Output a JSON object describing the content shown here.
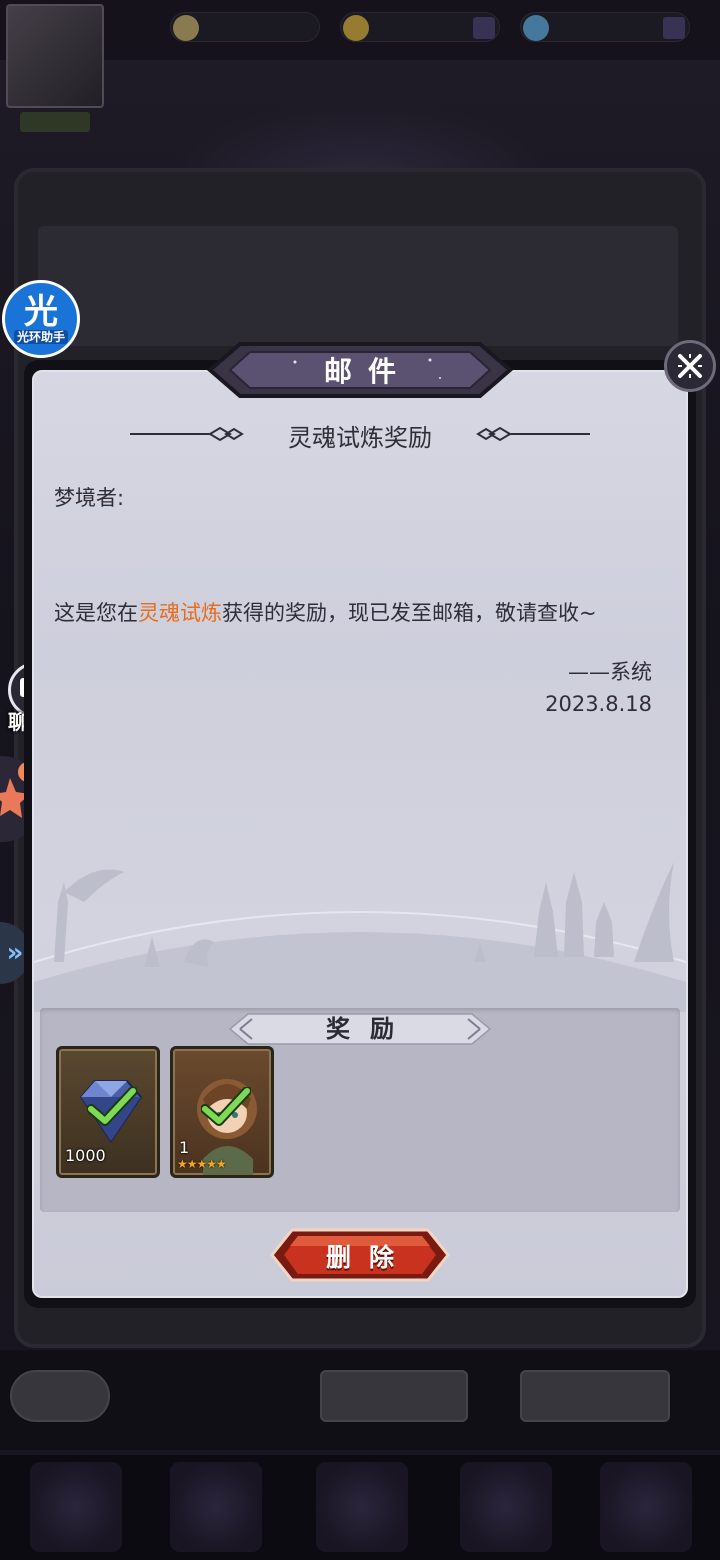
{
  "dialog": {
    "header": "邮件",
    "close_icon": "close-x-icon",
    "mail_title": "灵魂试炼奖励",
    "greeting": "梦境者:",
    "body_prefix": "这是您在",
    "body_highlight": "灵魂试炼",
    "body_suffix": "获得的奖励，现已发至邮箱，敬请查收~",
    "signature": "——系统",
    "date": "2023.8.18",
    "rewards_title": "奖励",
    "rewards": [
      {
        "name": "diamond",
        "count": "1000",
        "icon": "diamond-icon",
        "claimed": true
      },
      {
        "name": "hero-card",
        "count": "1",
        "stars": "★★★★★",
        "icon": "hero-portrait-icon",
        "claimed": true
      }
    ],
    "delete_label": "删除"
  },
  "floating": {
    "helper_big": "光",
    "helper_small": "光环助手",
    "chat_label": "聊天"
  },
  "colors": {
    "highlight": "#e46d1f",
    "delete_button": "#c8321f",
    "dialog_bg": "#d3d4df"
  }
}
